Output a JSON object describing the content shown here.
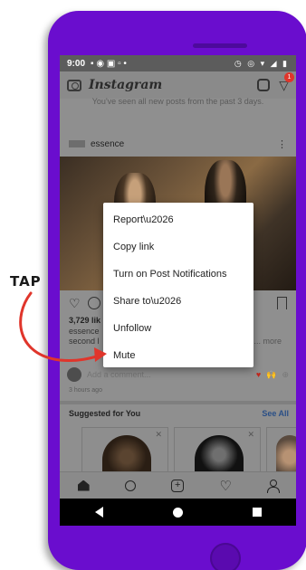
{
  "status_bar": {
    "time": "9:00",
    "left_icons": "▪ ◉ ▣ ▫ •",
    "right_icons": "◷ ◎ ▾ ◢ ▮"
  },
  "app_bar": {
    "logo": "Instagram",
    "dm_badge": "1"
  },
  "feed": {
    "seen_notice": "You've seen all new posts from the past 3 days.",
    "post": {
      "username": "essence",
      "likes": "3,729 lik",
      "caption_line1": "essence",
      "caption_line2": "second l",
      "more": "... more",
      "comment_placeholder": "Add a comment...",
      "emoji_heart": "♥",
      "emoji_clap": "🙌",
      "emoji_plus": "⊕",
      "time_ago": "3 hours ago"
    },
    "suggested": {
      "title": "Suggested for You",
      "see_all": "See All",
      "dismiss": "✕"
    }
  },
  "menu": {
    "items": [
      {
        "label": "Report\\u2026"
      },
      {
        "label": "Copy link"
      },
      {
        "label": "Turn on Post Notifications"
      },
      {
        "label": "Share to\\u2026"
      },
      {
        "label": "Unfollow"
      },
      {
        "label": "Mute"
      }
    ]
  },
  "annotation": {
    "tap_label": "TAP",
    "color": "#e0352b"
  },
  "colors": {
    "phone": "#6a0dce",
    "overlay": "#8f8f8f",
    "link": "#2a4f86"
  }
}
